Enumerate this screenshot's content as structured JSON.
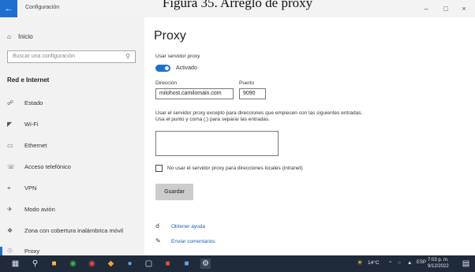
{
  "caption": "Figura 35. Arreglo de proxy",
  "window": {
    "title": "Configuración",
    "back_icon": "back-arrow-icon",
    "minimize": "–",
    "maximize": "□",
    "close": "×"
  },
  "sidebar": {
    "home": "Inicio",
    "search_placeholder": "Buscar una configuración",
    "section": "Red e Internet",
    "items": [
      {
        "label": "Estado",
        "icon": "globe-icon"
      },
      {
        "label": "Wi-Fi",
        "icon": "wifi-icon"
      },
      {
        "label": "Ethernet",
        "icon": "ethernet-icon"
      },
      {
        "label": "Acceso telefónico",
        "icon": "dialup-icon"
      },
      {
        "label": "VPN",
        "icon": "vpn-icon"
      },
      {
        "label": "Modo avión",
        "icon": "airplane-icon"
      },
      {
        "label": "Zona con cobertura inalámbrica móvil",
        "icon": "hotspot-icon"
      },
      {
        "label": "Proxy",
        "icon": "proxy-icon",
        "active": true
      }
    ]
  },
  "main": {
    "title": "Proxy",
    "use_proxy_label": "Usar servidor proxy",
    "toggle_state": "Activado",
    "address_label": "Dirección",
    "address_value": "milohost.camilomain.com",
    "port_label": "Puerto",
    "port_value": "9090",
    "exceptions_text": "Usar el servidor proxy excepto para direcciones que empiecen con las siguientes entradas. Usa el punto y coma (;) para separar las entradas.",
    "exceptions_value": "",
    "local_checkbox_label": "No usar el servidor proxy para direcciones locales (intranet)",
    "save_label": "Guardar",
    "help_link": "Obtener ayuda",
    "feedback_link": "Enviar comentarios"
  },
  "taskbar": {
    "temperature": "14°C",
    "language": "ESP",
    "time": "7:03 p. m.",
    "date": "9/12/2022"
  },
  "colors": {
    "accent": "#1e6fd0",
    "taskbar": "#1f2a3a",
    "sidebar": "#f2f2f2"
  }
}
